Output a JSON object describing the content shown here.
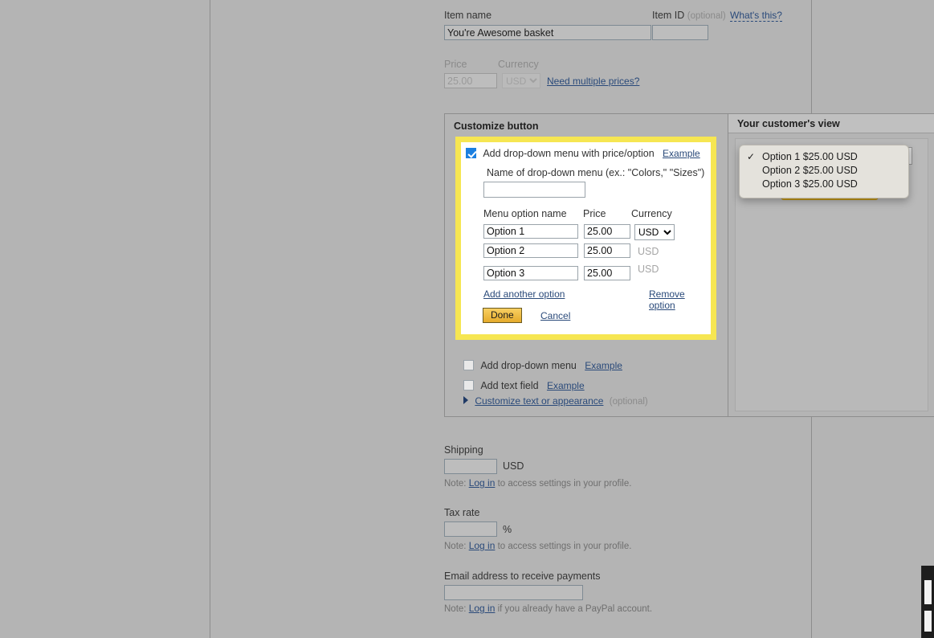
{
  "form": {
    "item_name_label": "Item name",
    "item_name_value": "You're Awesome basket",
    "item_id_label": "Item ID",
    "item_id_optional": "(optional)",
    "item_id_value": "",
    "whats_this": "What's this?",
    "price_label": "Price",
    "price_value": "25.00",
    "currency_label": "Currency",
    "currency_value": "USD",
    "need_multiple_prices": "Need multiple prices?"
  },
  "customize": {
    "title": "Customize button",
    "dropdown_with_price": {
      "checkbox_label": "Add drop-down menu with price/option",
      "checked": true,
      "example_link": "Example",
      "name_label": "Name of drop-down menu (ex.: \"Colors,\" \"Sizes\")",
      "name_value": "",
      "headers": {
        "option": "Menu option name",
        "price": "Price",
        "currency": "Currency"
      },
      "rows": [
        {
          "name": "Option 1",
          "price": "25.00",
          "currency": "USD",
          "currency_enabled": true
        },
        {
          "name": "Option 2",
          "price": "25.00",
          "currency": "USD",
          "currency_enabled": false
        },
        {
          "name": "Option 3",
          "price": "25.00",
          "currency": "USD",
          "currency_enabled": false
        }
      ],
      "add_another": "Add another option",
      "remove_option": "Remove option",
      "done_label": "Done",
      "cancel_label": "Cancel"
    },
    "add_dropdown_menu": {
      "label": "Add drop-down menu",
      "example_link": "Example",
      "checked": false
    },
    "add_text_field": {
      "label": "Add text field",
      "example_link": "Example",
      "checked": false
    },
    "customize_text": {
      "label": "Customize text or appearance",
      "optional": "(optional)"
    }
  },
  "customer_view": {
    "title": "Your customer's view",
    "select_arrow_icon": "check-mark-icon",
    "open_dropdown": {
      "selected_index": 0,
      "items": [
        "Option 1 $25.00 USD",
        "Option 2 $25.00 USD",
        "Option 3 $25.00 USD"
      ],
      "check_glyph": "✓"
    }
  },
  "shipping": {
    "label": "Shipping",
    "value": "",
    "unit": "USD",
    "note_prefix": "Note:",
    "note_link": "Log in",
    "note_suffix": "to access settings in your profile."
  },
  "tax": {
    "label": "Tax rate",
    "value": "",
    "unit": "%",
    "note_prefix": "Note:",
    "note_link": "Log in",
    "note_suffix": "to access settings in your profile."
  },
  "email": {
    "label": "Email address to receive payments",
    "value": "",
    "note_prefix": "Note:",
    "note_link": "Log in",
    "note_suffix": "if you already have a PayPal account."
  },
  "colors": {
    "page_background": "#b4b4b4",
    "highlight_yellow": "#f6e652",
    "checkbox_blue": "#1b7fe0",
    "button_gold": "#e5ab2b",
    "link_blue": "#2a4a7a",
    "popup_background": "#e4e2dc"
  }
}
